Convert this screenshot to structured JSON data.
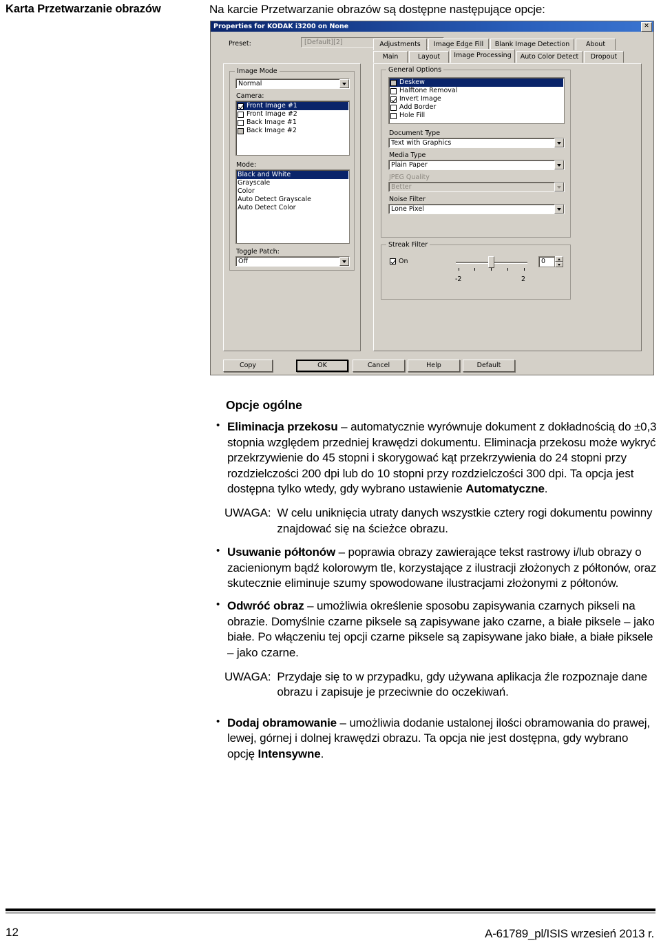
{
  "margin_heading": "Karta Przetwarzanie obrazów",
  "intro": "Na karcie Przetwarzanie obrazów są dostępne następujące opcje:",
  "dialog": {
    "title": "Properties for KODAK i3200 on None",
    "close_label": "✕",
    "preset_label": "Preset:",
    "preset_value": "[Default][2]",
    "image_mode": {
      "group_title": "Image Mode",
      "combo_value": "Normal",
      "camera_label": "Camera:",
      "camera_items": [
        {
          "label": "Front Image #1",
          "checked": true,
          "selected": true,
          "gray": false
        },
        {
          "label": "Front Image #2",
          "checked": false,
          "selected": false,
          "gray": false
        },
        {
          "label": "Back Image #1",
          "checked": false,
          "selected": false,
          "gray": false
        },
        {
          "label": "Back Image #2",
          "checked": false,
          "selected": false,
          "gray": true
        }
      ],
      "mode_label": "Mode:",
      "mode_items": [
        {
          "label": "Black and White",
          "selected": true
        },
        {
          "label": "Grayscale",
          "selected": false
        },
        {
          "label": "Color",
          "selected": false
        },
        {
          "label": "Auto Detect Grayscale",
          "selected": false
        },
        {
          "label": "Auto Detect Color",
          "selected": false
        }
      ],
      "toggle_patch_label": "Toggle Patch:",
      "toggle_patch_value": "Off"
    },
    "tabs_row1": [
      "Adjustments",
      "Image Edge Fill",
      "Blank Image Detection",
      "About"
    ],
    "tabs_row2": [
      "Main",
      "Layout",
      "Image Processing",
      "Auto Color Detect",
      "Dropout"
    ],
    "active_tab": "Image Processing",
    "general_options": {
      "group_title": "General Options",
      "items": [
        {
          "label": "Deskew",
          "checked": false,
          "selected": true,
          "gray": true
        },
        {
          "label": "Halftone Removal",
          "checked": false,
          "selected": false,
          "gray": false
        },
        {
          "label": "Invert Image",
          "checked": true,
          "selected": false,
          "gray": false
        },
        {
          "label": "Add Border",
          "checked": false,
          "selected": false,
          "gray": false
        },
        {
          "label": "Hole Fill",
          "checked": false,
          "selected": false,
          "gray": false
        }
      ],
      "document_type_label": "Document Type",
      "document_type_value": "Text with Graphics",
      "media_type_label": "Media Type",
      "media_type_value": "Plain Paper",
      "jpeg_quality_label": "JPEG Quality",
      "jpeg_quality_value": "Better",
      "noise_filter_label": "Noise Filter",
      "noise_filter_value": "Lone Pixel"
    },
    "streak_filter": {
      "group_title": "Streak Filter",
      "on_label": "On",
      "on_checked": true,
      "value": "0",
      "scale_min": "-2",
      "scale_max": "2"
    },
    "buttons": [
      "Copy",
      "OK",
      "Cancel",
      "Help",
      "Default"
    ],
    "default_button": "OK"
  },
  "section_heading": "Opcje ogólne",
  "bullets": [
    {
      "term": "Eliminacja przekosu",
      "dash": " – ",
      "text": "automatycznie wyrównuje dokument z dokładnością do ±0,3 stopnia względem przedniej krawędzi dokumentu. Eliminacja przekosu może wykryć przekrzywienie do 45 stopni i skorygować kąt przekrzywienia do 24 stopni przy rozdzielczości 200 dpi lub do 10 stopni przy rozdzielczości 300 dpi. Ta opcja jest dostępna tylko wtedy, gdy wybrano ustawienie ",
      "tail_bold": "Automatyczne",
      "tail": "."
    },
    {
      "term": "Usuwanie półtonów",
      "dash": " – ",
      "text": "poprawia obrazy zawierające tekst rastrowy i/lub obrazy o zacienionym bądź kolorowym tle, korzystające z ilustracji złożonych z półtonów, oraz skutecznie eliminuje szumy spowodowane ilustracjami złożonymi z półtonów.",
      "tail_bold": "",
      "tail": ""
    },
    {
      "term": "Odwróć obraz",
      "dash": " – ",
      "text": "umożliwia określenie sposobu zapisywania czarnych pikseli na obrazie. Domyślnie czarne piksele są zapisywane jako czarne, a białe piksele – jako białe. Po włączeniu tej opcji czarne piksele są zapisywane jako białe, a białe piksele – jako czarne.",
      "tail_bold": "",
      "tail": ""
    },
    {
      "term": "Dodaj obramowanie",
      "dash": " – ",
      "text": "umożliwia dodanie ustalonej ilości obramowania do prawej, lewej, górnej i dolnej krawędzi obrazu. Ta opcja nie jest dostępna, gdy wybrano opcję ",
      "tail_bold": "Intensywne",
      "tail": "."
    }
  ],
  "notes": [
    {
      "label": "UWAGA:",
      "text": "W celu uniknięcia utraty danych wszystkie cztery rogi dokumentu powinny znajdować się na ścieżce obrazu."
    },
    {
      "label": "UWAGA:",
      "text": "Przydaje się to w przypadku, gdy używana aplikacja źle rozpoznaje dane obrazu i zapisuje je przeciwnie do oczekiwań."
    }
  ],
  "footer": {
    "page_number": "12",
    "doc_id": "A-61789_pl/ISIS  wrzesień 2013 r."
  }
}
